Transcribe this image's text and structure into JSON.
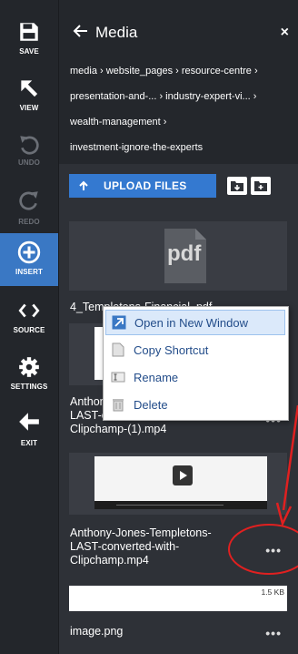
{
  "toolbar": {
    "items": [
      {
        "label": "SAVE"
      },
      {
        "label": "VIEW"
      },
      {
        "label": "UNDO"
      },
      {
        "label": "REDO"
      },
      {
        "label": "INSERT"
      },
      {
        "label": "SOURCE"
      },
      {
        "label": "SETTINGS"
      },
      {
        "label": "EXIT"
      }
    ]
  },
  "panel": {
    "title": "Media",
    "close_label": "×",
    "breadcrumbs": [
      "media › website_pages › resource-centre ›",
      "presentation-and-... › industry-expert-vi... ›",
      "wealth-management ›",
      "investment-ignore-the-experts"
    ],
    "upload_label": "UPLOAD FILES"
  },
  "files": [
    {
      "name": "4_Templetons-Financial .pdf",
      "thumb_text": "pdf",
      "more": "•••"
    },
    {
      "name": "Anthony-Jones-Templetons-LAST-converted-with-Clipchamp-(1).mp4",
      "more": "•••"
    },
    {
      "name": "Anthony-Jones-Templetons-LAST-converted-with-Clipchamp.mp4",
      "more": "•••"
    },
    {
      "name": "image.png",
      "size": "1.5 KB",
      "more": "•••"
    }
  ],
  "context_menu": {
    "items": [
      {
        "label": "Open in New Window"
      },
      {
        "label": "Copy Shortcut"
      },
      {
        "label": "Rename"
      },
      {
        "label": "Delete"
      }
    ]
  },
  "colors": {
    "accent": "#3479d0",
    "annotation": "#e02020"
  }
}
